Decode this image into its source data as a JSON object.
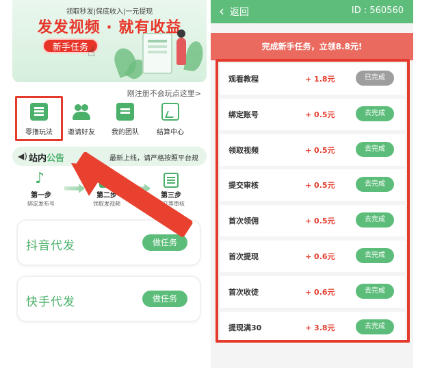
{
  "left": {
    "banner": {
      "tagline": "领取秒发|保底收入|一元提现",
      "title": "发发视频 · 就有收益",
      "newbie_button": "新手任务"
    },
    "hint": "刚注册不会玩点这里>",
    "icons": [
      {
        "label": "零撸玩法"
      },
      {
        "label": "邀请好友"
      },
      {
        "label": "我的团队"
      },
      {
        "label": "结算中心"
      }
    ],
    "notice": {
      "title_a": "站内",
      "title_b": "公告",
      "text": "最新上线，请严格按照平台规"
    },
    "steps": [
      {
        "name": "第一步",
        "desc": "绑定发布号"
      },
      {
        "name": "第二步",
        "desc": "领取发视频"
      },
      {
        "name": "第三步",
        "desc": "提交等审核"
      }
    ],
    "cards": [
      {
        "title": "抖音代发",
        "button": "做任务"
      },
      {
        "title": "快手代发",
        "button": "做任务"
      }
    ]
  },
  "right": {
    "back_label": "返回",
    "user_id": "ID : 560560",
    "promo": "完成新手任务，立领8.8元!",
    "tasks": [
      {
        "name": "观看教程",
        "reward": "+ 1.8元",
        "button": "已完成",
        "done": true
      },
      {
        "name": "绑定账号",
        "reward": "+ 0.5元",
        "button": "去完成",
        "done": false
      },
      {
        "name": "领取视频",
        "reward": "+ 0.5元",
        "button": "去完成",
        "done": false
      },
      {
        "name": "提交审核",
        "reward": "+ 0.5元",
        "button": "去完成",
        "done": false
      },
      {
        "name": "首次领佣",
        "reward": "+ 0.5元",
        "button": "去完成",
        "done": false
      },
      {
        "name": "首次提现",
        "reward": "+ 0.6元",
        "button": "去完成",
        "done": false
      },
      {
        "name": "首次收徒",
        "reward": "+ 0.6元",
        "button": "去完成",
        "done": false
      },
      {
        "name": "提现满30",
        "reward": "+ 3.8元",
        "button": "去完成",
        "done": false
      }
    ]
  },
  "colors": {
    "accent_green": "#5cbd7a",
    "highlight_red": "#e43a2c",
    "reward_red": "#e33b2c"
  }
}
